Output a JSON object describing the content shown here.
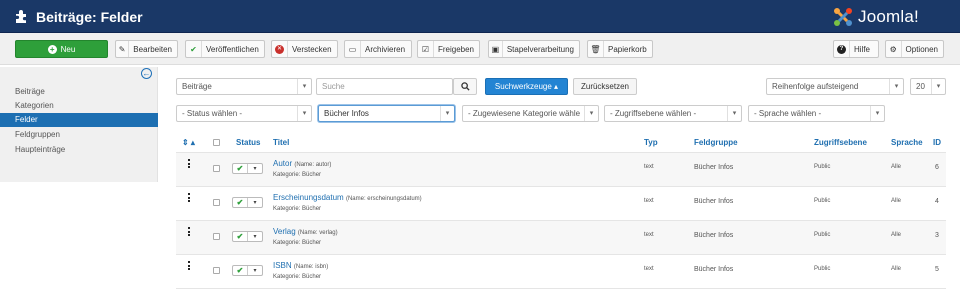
{
  "header": {
    "title": "Beiträge: Felder",
    "logo_text": "Joomla!"
  },
  "toolbar": {
    "new_label": "Neu",
    "buttons": [
      {
        "label": "Bearbeiten",
        "icon": "edit-icon"
      },
      {
        "label": "Veröffentlichen",
        "icon": "check-icon"
      },
      {
        "label": "Verstecken",
        "icon": "unpublish-icon"
      },
      {
        "label": "Archivieren",
        "icon": "archive-icon"
      },
      {
        "label": "Freigeben",
        "icon": "checkin-icon"
      },
      {
        "label": "Stapelverarbeitung",
        "icon": "batch-icon"
      },
      {
        "label": "Papierkorb",
        "icon": "trash-icon"
      }
    ],
    "help_label": "Hilfe",
    "options_label": "Optionen"
  },
  "sidebar": {
    "items": [
      {
        "label": "Beiträge",
        "active": false
      },
      {
        "label": "Kategorien",
        "active": false
      },
      {
        "label": "Felder",
        "active": true
      },
      {
        "label": "Feldgruppen",
        "active": false
      },
      {
        "label": "Haupteinträge",
        "active": false
      }
    ]
  },
  "filters": {
    "context": "Beiträge",
    "search_placeholder": "Suche",
    "search_tools_label": "Suchwerkzeuge ▴",
    "reset_label": "Zurücksetzen",
    "ordering": "Reihenfolge aufsteigend",
    "limit": "20",
    "status": "- Status wählen -",
    "group": "Bücher Infos",
    "category": "- Zugewiesene Kategorie wähle",
    "access": "- Zugriffsebene wählen -",
    "language": "- Sprache wählen -"
  },
  "table": {
    "headers": {
      "order": "⇕ ▴",
      "status": "Status",
      "title": "Titel",
      "type": "Typ",
      "group": "Feldgruppe",
      "access": "Zugriffsebene",
      "language": "Sprache",
      "id": "ID"
    },
    "rows": [
      {
        "title": "Autor",
        "name": "(Name: autor)",
        "category": "Kategorie: Bücher",
        "type": "text",
        "group": "Bücher Infos",
        "access": "Public",
        "language": "Alle",
        "id": "6"
      },
      {
        "title": "Erscheinungsdatum",
        "name": "(Name: erscheinungsdatum)",
        "category": "Kategorie: Bücher",
        "type": "text",
        "group": "Bücher Infos",
        "access": "Public",
        "language": "Alle",
        "id": "4"
      },
      {
        "title": "Verlag",
        "name": "(Name: verlag)",
        "category": "Kategorie: Bücher",
        "type": "text",
        "group": "Bücher Infos",
        "access": "Public",
        "language": "Alle",
        "id": "3"
      },
      {
        "title": "ISBN",
        "name": "(Name: isbn)",
        "category": "Kategorie: Bücher",
        "type": "text",
        "group": "Bücher Infos",
        "access": "Public",
        "language": "Alle",
        "id": "5"
      }
    ]
  },
  "colors": {
    "header_bg": "#1a3867",
    "new_button": "#2e9f3a",
    "active_sidebar": "#1d6fb2",
    "link": "#1f6fb0",
    "primary_button": "#2384d3"
  }
}
